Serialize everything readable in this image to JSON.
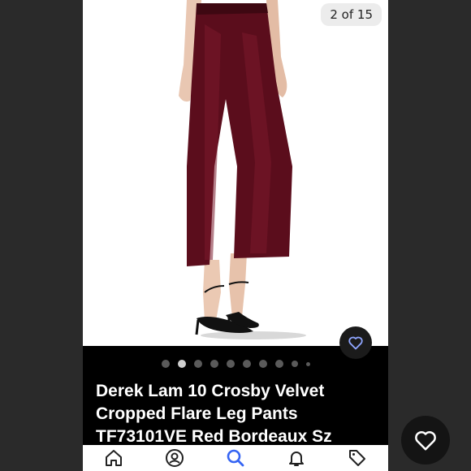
{
  "listing": {
    "image_counter": "2 of 15",
    "title": "Derek Lam 10 Crosby Velvet Cropped Flare Leg Pants TF73101VE Red Bordeaux Sz"
  },
  "carousel": {
    "dot_count": 10,
    "active_index": 1
  },
  "icons": {
    "like": "heart-icon",
    "home": "home-icon",
    "account": "account-icon",
    "search": "search-icon",
    "notifications": "bell-icon",
    "sell": "tag-icon"
  },
  "colors": {
    "accent": "#3665f3",
    "heart_small": "#8fa5ff",
    "tab_icon": "#222222"
  }
}
